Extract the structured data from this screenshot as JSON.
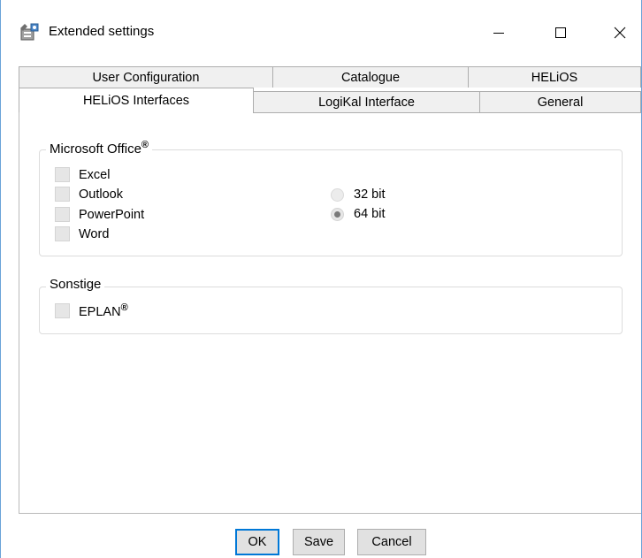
{
  "window": {
    "title": "Extended settings",
    "app_icon": "settings-app-icon",
    "controls": {
      "minimize": "—",
      "maximize": "☐",
      "close": "✕"
    }
  },
  "tabs": {
    "back_row": [
      "User Configuration",
      "Catalogue",
      "HELiOS"
    ],
    "front_row": [
      "HELiOS Interfaces",
      "LogiKal Interface",
      "General"
    ],
    "active": "HELiOS Interfaces"
  },
  "office_group": {
    "title": "Microsoft Office",
    "title_mark": "®",
    "checkboxes": [
      {
        "label": "Excel",
        "checked": false
      },
      {
        "label": "Outlook",
        "checked": false
      },
      {
        "label": "PowerPoint",
        "checked": false
      },
      {
        "label": "Word",
        "checked": false
      }
    ],
    "radios": [
      {
        "label": "32 bit",
        "selected": false
      },
      {
        "label": "64 bit",
        "selected": true
      }
    ]
  },
  "other_group": {
    "title": "Sonstige",
    "checkboxes": [
      {
        "label": "EPLAN",
        "mark": "®",
        "checked": false
      }
    ]
  },
  "buttons": {
    "ok": "OK",
    "save": "Save",
    "cancel": "Cancel"
  },
  "colors": {
    "window_border": "#6aa3d8",
    "default_button_border": "#0078d7",
    "tab_inactive_bg": "#f0f0f0"
  }
}
